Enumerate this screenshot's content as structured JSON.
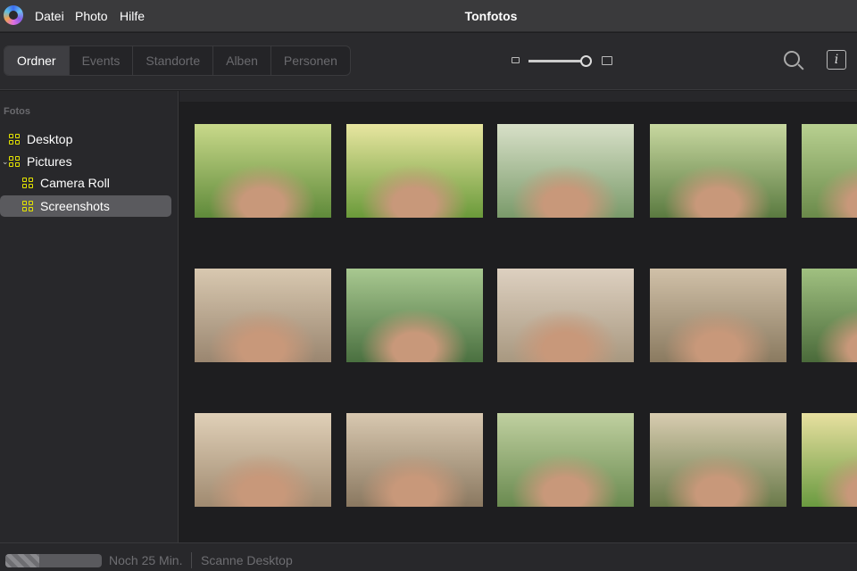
{
  "app": {
    "title": "Tonfotos"
  },
  "menu": [
    "Datei",
    "Photo",
    "Hilfe"
  ],
  "tabs": [
    {
      "label": "Ordner",
      "active": true
    },
    {
      "label": "Events"
    },
    {
      "label": "Standorte"
    },
    {
      "label": "Alben"
    },
    {
      "label": "Personen"
    }
  ],
  "zoom": {
    "level": 1.0
  },
  "sidebar": {
    "section": "Fotos",
    "items": [
      {
        "label": "Desktop",
        "icon": "folder-grid-icon"
      },
      {
        "label": "Pictures",
        "icon": "folder-grid-icon",
        "expanded": true
      },
      {
        "label": "Camera Roll",
        "icon": "folder-grid-icon"
      },
      {
        "label": "Screenshots",
        "icon": "folder-grid-icon",
        "selected": true
      }
    ]
  },
  "photos": [
    {
      "scene": "family-park",
      "colors": [
        "#c9d98a",
        "#5f8a3a"
      ]
    },
    {
      "scene": "family-walking-meadow",
      "colors": [
        "#e8e6a0",
        "#6a9a3a"
      ]
    },
    {
      "scene": "family-portrait",
      "colors": [
        "#d8e0c8",
        "#7a9a6a"
      ]
    },
    {
      "scene": "family-park",
      "colors": [
        "#c8d8a0",
        "#5a7a40"
      ]
    },
    {
      "scene": "family-park",
      "colors": [
        "#b8d090",
        "#6a8a4a"
      ]
    },
    {
      "scene": "family-studio",
      "colors": [
        "#d8c8b0",
        "#9a8670"
      ]
    },
    {
      "scene": "family-outdoor",
      "colors": [
        "#a8c890",
        "#4a7040"
      ]
    },
    {
      "scene": "family-studio",
      "colors": [
        "#ddd0c0",
        "#a89880"
      ]
    },
    {
      "scene": "family-studio",
      "colors": [
        "#d0c0a8",
        "#8a7a60"
      ]
    },
    {
      "scene": "family-park",
      "colors": [
        "#a0c080",
        "#4a6a3a"
      ]
    },
    {
      "scene": "family-studio",
      "colors": [
        "#e0d0b8",
        "#a08a70"
      ]
    },
    {
      "scene": "family-studio",
      "colors": [
        "#d8c8b0",
        "#8a7860"
      ]
    },
    {
      "scene": "family-outdoor",
      "colors": [
        "#c0d0a0",
        "#6a8a50"
      ]
    },
    {
      "scene": "family-tree-illustration",
      "colors": [
        "#d8ccb0",
        "#6a7a4a"
      ]
    },
    {
      "scene": "man-walking-park",
      "colors": [
        "#e8e0a0",
        "#6a9a40"
      ]
    }
  ],
  "status": {
    "progress_percent": 35,
    "remaining": "Noch 25 Min.",
    "task": "Scanne Desktop"
  }
}
